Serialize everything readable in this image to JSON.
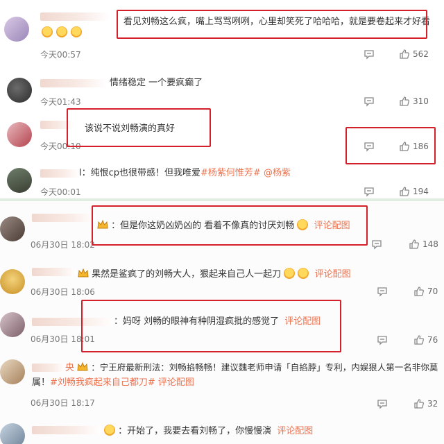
{
  "feed_top": {
    "comments": [
      {
        "text": "看见刘畅这么疯，嘴上骂骂咧咧，心里却笑死了哈哈哈，就是要卷起来才好看",
        "time": "今天00:57",
        "likes": "562"
      },
      {
        "text": "情绪稳定 一个要疯癫了",
        "time": "今天01:43",
        "likes": "310"
      },
      {
        "text": "该说不说刘畅演的真好",
        "time": "今天00:10",
        "likes": "186"
      },
      {
        "text_prefix": "l：纯恨cp也很带感！但我唯爱",
        "tag1": "#杨紫何惟芳#",
        "tag2": "@杨紫",
        "time": "今天00:01",
        "likes": "194"
      }
    ]
  },
  "feed_bottom": {
    "comments": [
      {
        "text": "：但是你这奶凶奶凶的 看着不像真的讨厌刘畅",
        "cite": "评论配图",
        "time": "06月30日 18:02",
        "likes": "148"
      },
      {
        "text": "果然是鲨疯了的刘畅大人，狠起来自己人一起刀",
        "cite": "评论配图",
        "time": "06月30日 18:06",
        "likes": "70"
      },
      {
        "text": "：妈呀 刘畅的眼神有种阴湿疯批的感觉了",
        "cite": "评论配图",
        "time": "06月30日 18:01",
        "likes": "76"
      },
      {
        "name_tail": "央",
        "line1": "：宁王府最新刑法：刘畅掐畅畅！建议魏老师申请「自掐脖」专利，内娱狠人第一名非你莫",
        "line2_prefix": "属！",
        "tag": "#刘畅我疯起来自己都刀#",
        "cite": "评论配图",
        "time": "06月30日 18:17",
        "likes": "32"
      },
      {
        "text": "：开始了，我要去看刘畅了，你慢慢演",
        "cite": "评论配图"
      }
    ]
  },
  "icons": {
    "comment": "comment-icon",
    "like": "thumbs-up-icon",
    "reaction": "laughing-emoji-icon",
    "badge": "crown-badge-icon"
  },
  "colors": {
    "highlight_box": "#d3202a",
    "link": "#eb7350",
    "divider": "#dfeee0"
  }
}
